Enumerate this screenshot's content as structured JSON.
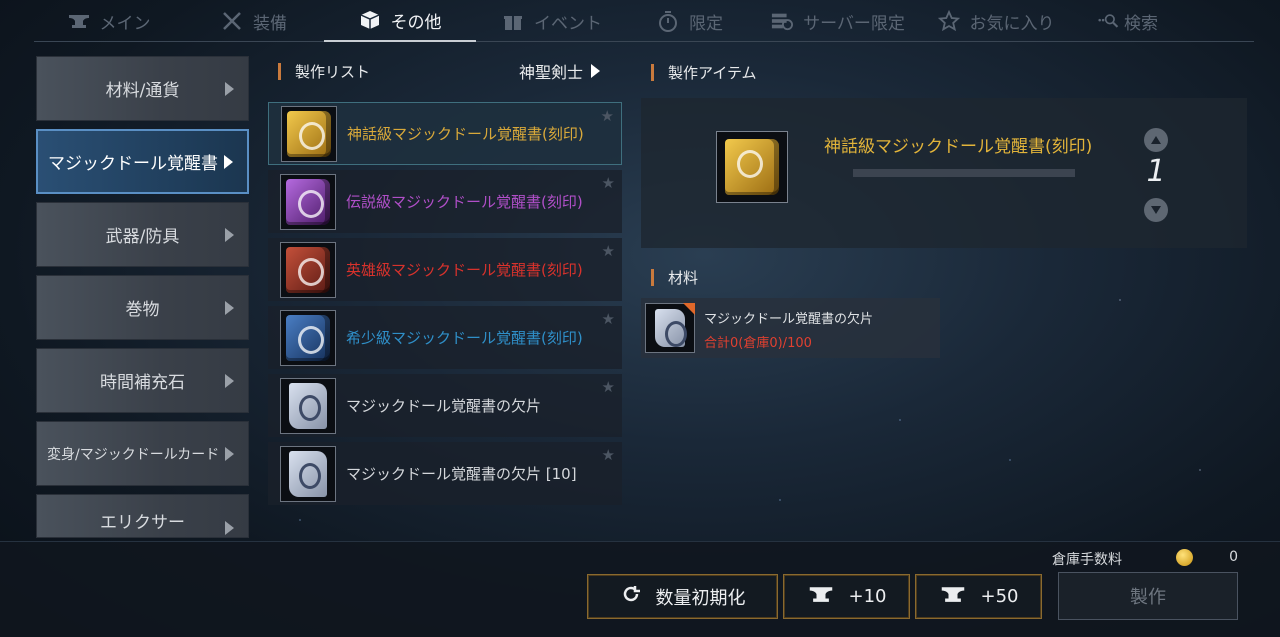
{
  "nav": {
    "tabs": [
      {
        "label": "メイン",
        "icon": "anvil-icon"
      },
      {
        "label": "装備",
        "icon": "crossed-swords-icon"
      },
      {
        "label": "その他",
        "icon": "box-icon",
        "active": true
      },
      {
        "label": "イベント",
        "icon": "gift-icon"
      },
      {
        "label": "限定",
        "icon": "stopwatch-icon"
      },
      {
        "label": "サーバー限定",
        "icon": "server-icon"
      },
      {
        "label": "お気に入り",
        "icon": "star-icon"
      },
      {
        "label": "検索",
        "icon": "search-icon"
      }
    ]
  },
  "categories": [
    {
      "label": "材料/通貨"
    },
    {
      "label": "マジックドール覚醒書",
      "active": true
    },
    {
      "label": "武器/防具"
    },
    {
      "label": "巻物"
    },
    {
      "label": "時間補充石"
    },
    {
      "label": "変身/マジックドールカード"
    },
    {
      "label": "エリクサー"
    }
  ],
  "craft_list": {
    "header": "製作リスト",
    "class_filter": "神聖剣士",
    "items": [
      {
        "name": "神話級マジックドール覚醒書(刻印)",
        "color": "#d9a93a",
        "icon": "gold-book-icon",
        "selected": true
      },
      {
        "name": "伝説級マジックドール覚醒書(刻印)",
        "color": "#b04fc8",
        "icon": "purple-book-icon"
      },
      {
        "name": "英雄級マジックドール覚醒書(刻印)",
        "color": "#d8322c",
        "icon": "red-book-icon"
      },
      {
        "name": "希少級マジックドール覚醒書(刻印)",
        "color": "#2f8fc8",
        "icon": "blue-book-icon"
      },
      {
        "name": "マジックドール覚醒書の欠片",
        "color": "#d4d7db",
        "icon": "scroll-fragment-icon"
      },
      {
        "name": "マジックドール覚醒書の欠片 [10]",
        "color": "#d4d7db",
        "icon": "scroll-fragment-icon"
      }
    ]
  },
  "craft_item": {
    "header": "製作アイテム",
    "name": "神話級マジックドール覚醒書(刻印)",
    "name_color": "#e2b43a",
    "quantity": "1"
  },
  "materials": {
    "header": "材料",
    "items": [
      {
        "name": "マジックドール覚醒書の欠片",
        "count": "合計0(倉庫0)/100"
      }
    ]
  },
  "footer": {
    "fee_label": "倉庫手数料",
    "fee_value": "0",
    "reset_label": "数量初期化",
    "plus10_label": "+10",
    "plus50_label": "+50",
    "craft_label": "製作"
  }
}
